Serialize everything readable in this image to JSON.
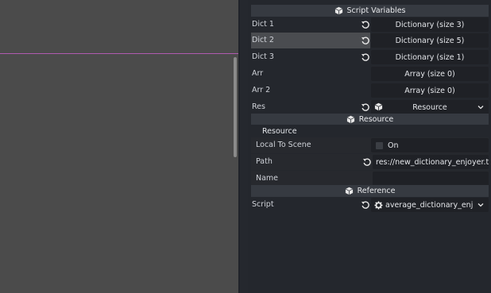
{
  "script_variables": {
    "header": "Script Variables",
    "rows": [
      {
        "label": "Dict 1",
        "value": "Dictionary (size 3)"
      },
      {
        "label": "Dict 2",
        "value": "Dictionary (size 5)"
      },
      {
        "label": "Dict 3",
        "value": "Dictionary (size 1)"
      },
      {
        "label": "Arr",
        "value": "Array (size 0)"
      },
      {
        "label": "Arr 2",
        "value": "Array (size 0)"
      }
    ],
    "res": {
      "label": "Res",
      "value": "Resource"
    }
  },
  "resource_section": {
    "header": "Resource",
    "subheader": "Resource",
    "local_to_scene": {
      "label": "Local To Scene",
      "value": "On"
    },
    "path": {
      "label": "Path",
      "value": "res://new_dictionary_enjoyer.t"
    },
    "name": {
      "label": "Name",
      "value": ""
    }
  },
  "reference_section": {
    "header": "Reference",
    "script": {
      "label": "Script",
      "value": "average_dictionary_enj"
    }
  },
  "colors": {
    "viewport_bg": "#4b4b4b",
    "guide_line": "#b05ab0",
    "inspector_bg": "#24272d",
    "header_bg": "#363a41",
    "selected_row": "#4a4c50"
  },
  "icons": [
    "cube-icon",
    "revert-icon",
    "chevron-down-icon",
    "gear-icon",
    "checkbox-icon"
  ]
}
